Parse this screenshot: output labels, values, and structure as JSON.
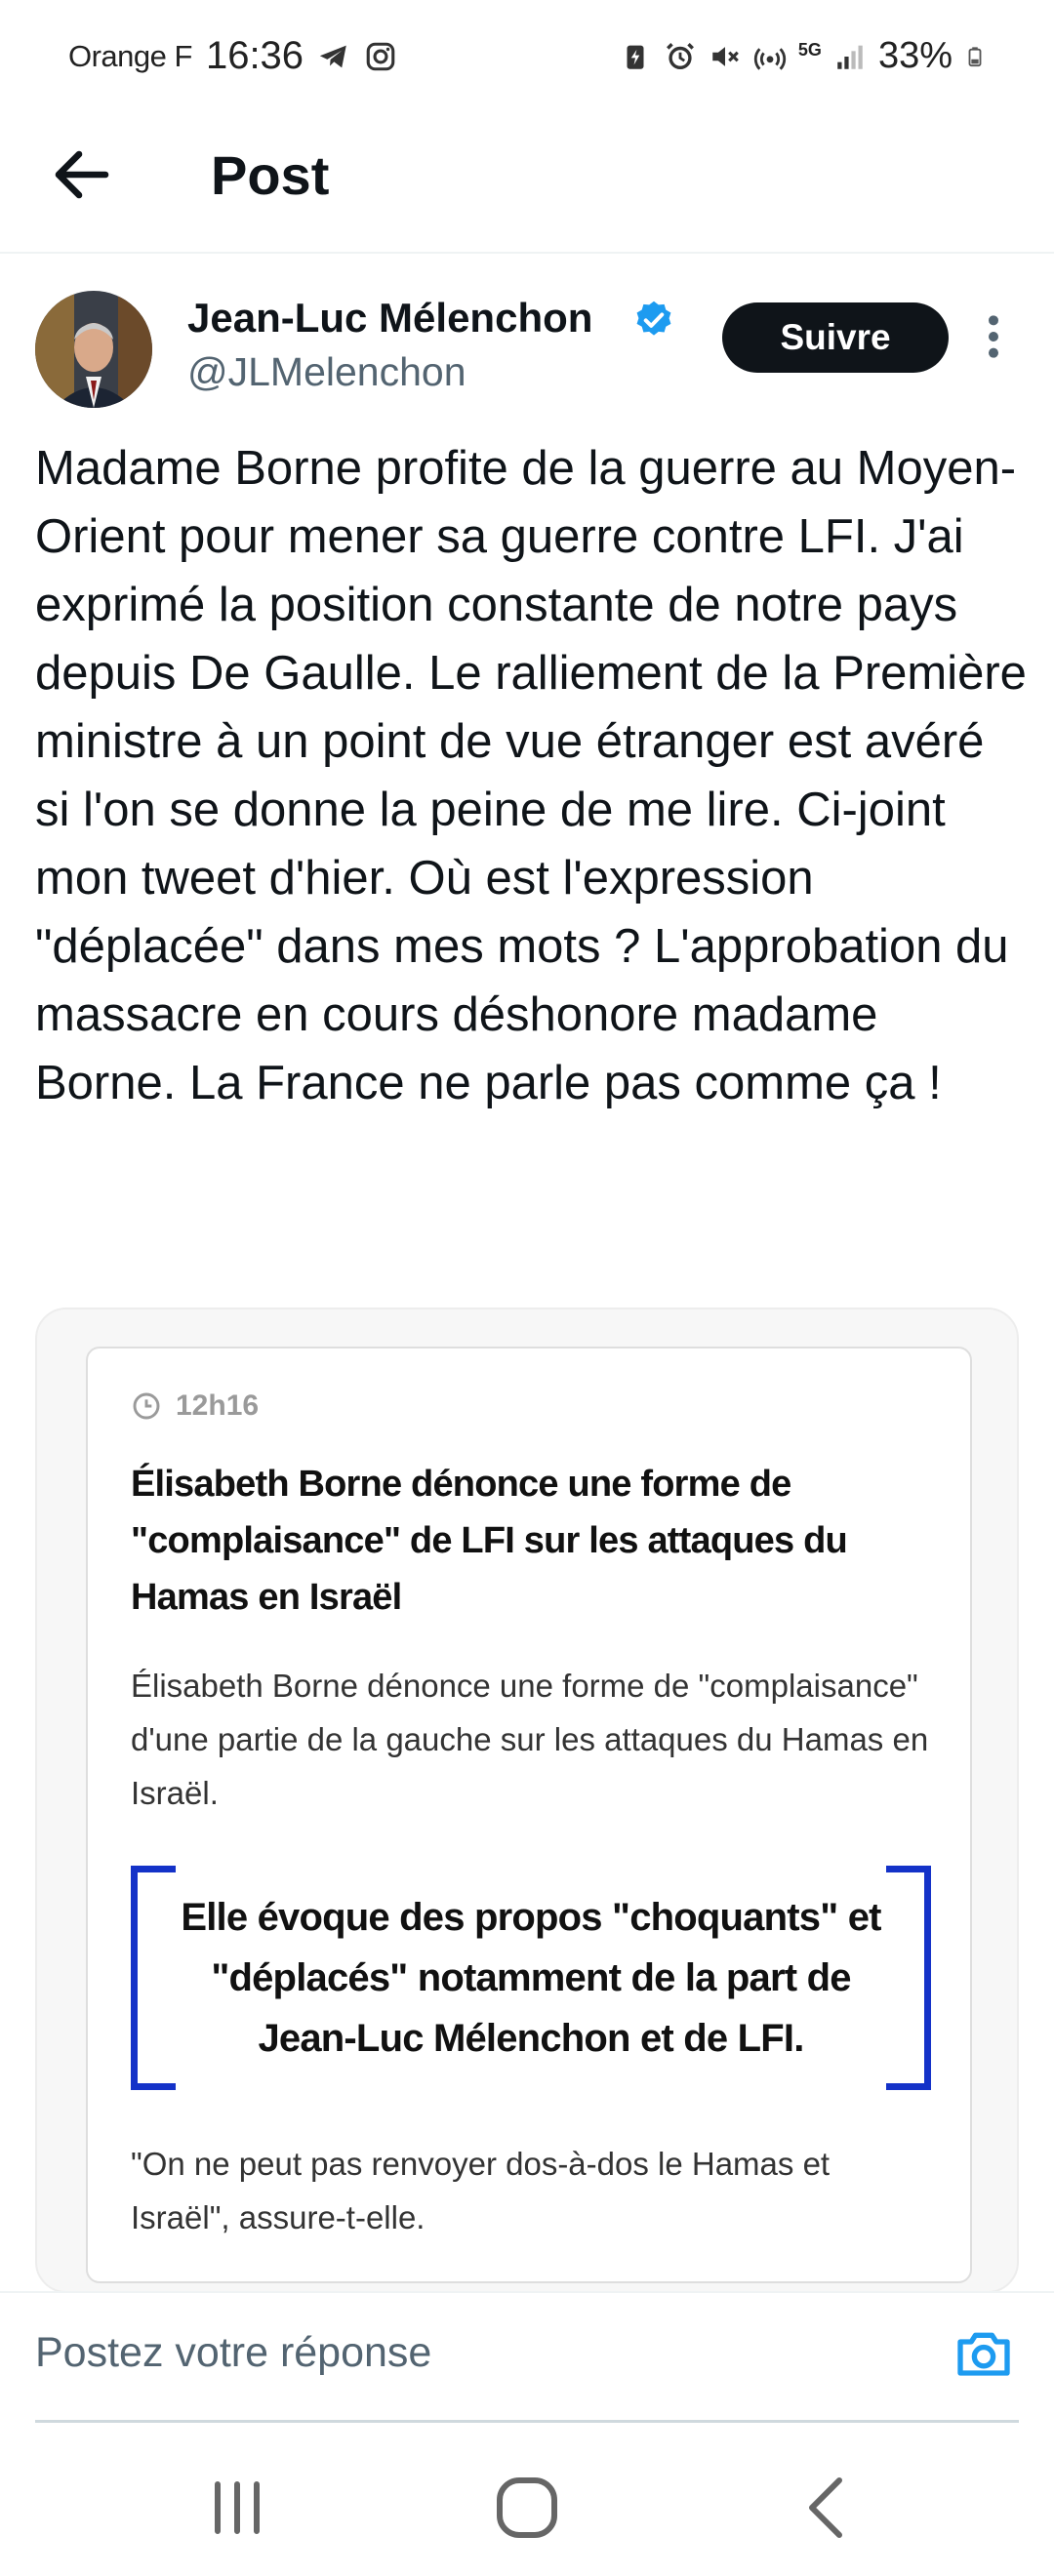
{
  "status_bar": {
    "carrier": "Orange F",
    "time": "16:36",
    "battery": "33%",
    "network": "5G",
    "icons": [
      "telegram-icon",
      "instagram-icon",
      "battery-saver-icon",
      "alarm-icon",
      "mute-icon",
      "hotspot-icon",
      "signal-icon",
      "battery-icon"
    ]
  },
  "header": {
    "title": "Post"
  },
  "post": {
    "author_name": "Jean-Luc Mélenchon",
    "author_handle": "@JLMelenchon",
    "verified": true,
    "follow_label": "Suivre",
    "text": "Madame Borne profite de la guerre au Moyen-Orient pour mener sa guerre contre LFI. J'ai exprimé la position constante de notre pays depuis De Gaulle. Le ralliement de la Première ministre à un point de vue étranger est avéré si l'on se donne la peine de me lire. Ci-joint mon tweet d'hier. Où est l'expression \"déplacée\" dans mes mots ? L'approbation du massacre en cours déshonore madame Borne. La France ne parle pas comme ça !"
  },
  "media": {
    "time": "12h16",
    "headline": "Élisabeth Borne dénonce une forme de \"complaisance\" de LFI sur les attaques du Hamas en Israël",
    "lead": "Élisabeth Borne dénonce une forme de \"complaisance\" d'une partie de la gauche sur les attaques du Hamas en Israël.",
    "quote": "Elle évoque des propos \"choquants\" et \"déplacés\" notamment de la part de Jean-Luc Mélenchon et de LFI.",
    "footer": "\"On ne peut pas renvoyer dos-à-dos le Hamas et Israël\", assure-t-elle."
  },
  "reply": {
    "placeholder": "Postez votre réponse"
  },
  "colors": {
    "verified": "#1d9bf0",
    "quote_bracket": "#1432c8",
    "follow_bg": "#0f1419",
    "muted_text": "#536471"
  }
}
